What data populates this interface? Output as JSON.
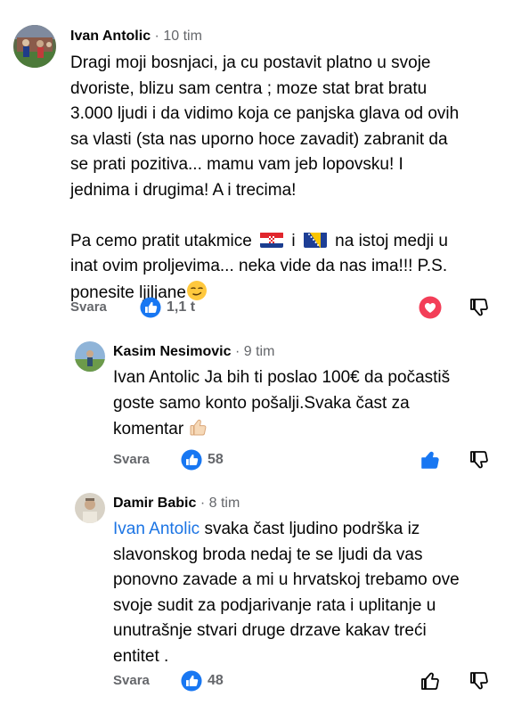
{
  "comments": [
    {
      "author": "Ivan Antolic",
      "time": "10 tim",
      "lines": [
        "Dragi moji bosnjaci, ja cu postavit platno u svoje",
        "dvoriste, blizu sam centra ; moze stat brat bratu",
        "3.000 ljudi i da vidimo koja ce panjska glava od ovih",
        "sa vlasti (sta nas uporno hoce zavadit) zabranit da",
        "se prati pozitiva... mamu vam jeb lopovsku! I",
        "jednima i drugima! A i trecima!"
      ],
      "line7_a": "Pa cemo pratit utakmice",
      "line7_b": "i",
      "line7_c": "na istoj medji u",
      "line8": "inat ovim proljevima... neka vide da nas ima!!! P.S.",
      "line9": "ponesite ljiljane",
      "flag_1": "croatia-flag",
      "flag_2": "bosnia-flag",
      "emoji": "smirking-face",
      "reply_label": "Svara",
      "reaction_count": "1,1 t",
      "reaction_icon": "like-icon",
      "my_reaction": "love-icon",
      "dislike_icon": "thumbs-down-icon"
    },
    {
      "author": "Kasim Nesimovic",
      "time": "9 tim",
      "lines": [
        "Ivan Antolic Ja bih ti poslao 100€ da  počastiš",
        "goste samo konto pošalji.Svaka čast za",
        "komentar"
      ],
      "emoji": "thumbs-up-emoji",
      "reply_label": "Svara",
      "reaction_count": "58",
      "reaction_icon": "like-icon",
      "my_reaction": "like-icon",
      "dislike_icon": "thumbs-down-icon"
    },
    {
      "author": "Damir Babic",
      "time": "8 tim",
      "mention": "Ivan Antolic",
      "line1_rest": " svaka čast ljudino podrška iz",
      "lines": [
        "slavonskog broda nedaj te se ljudi da vas",
        "ponovno zavade a mi u hrvatskoj trebamo ove",
        "svoje sudit za podjarivanje rata i uplitanje u",
        "unutrašnje stvari druge drzave kakav treći",
        "entitet ."
      ],
      "reply_label": "Svara",
      "reaction_count": "48",
      "reaction_icon": "like-icon",
      "my_reaction": "thumbs-up-outline-icon",
      "dislike_icon": "thumbs-down-icon"
    }
  ],
  "colors": {
    "accent": "#1b74e4",
    "love": "#e41e3f",
    "meta": "#65676b"
  },
  "separator": "·"
}
